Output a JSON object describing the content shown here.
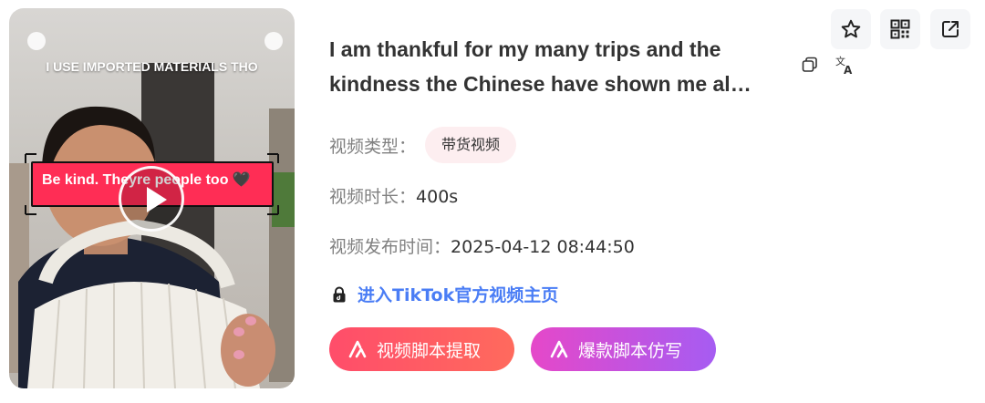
{
  "video": {
    "thumbnail": {
      "caption_top": "I USE IMPORTED MATERIALS THO",
      "caption_pink": "Be kind. Theyre people too 🖤",
      "play_icon": "play-icon"
    },
    "title": "I am thankful for my many trips and the kindness the Chinese have shown me al…",
    "copy_icon": "copy-icon",
    "translate_icon": "translate-icon"
  },
  "details": {
    "type_label": "视频类型：",
    "type_value": "带货视频",
    "duration_label": "视频时长：",
    "duration_value": "400s",
    "publish_label": "视频发布时间：",
    "publish_value": "2025-04-12 08:44:50"
  },
  "link": {
    "label": "进入TikTok官方视频主页",
    "icon": "tiktok-lock-icon"
  },
  "actions": {
    "extract_label": "视频脚本提取",
    "imitate_label": "爆款脚本仿写"
  },
  "toolbar": {
    "favorite_icon": "star-icon",
    "qr_icon": "qrcode-icon",
    "share_icon": "external-link-icon"
  },
  "colors": {
    "link": "#4a7df5",
    "badge_bg": "#fdeef0",
    "extract_btn": "#ff4d6a",
    "imitate_btn_from": "#e548c9",
    "imitate_btn_to": "#a65cf2",
    "pink_band": "#ff2d55"
  }
}
